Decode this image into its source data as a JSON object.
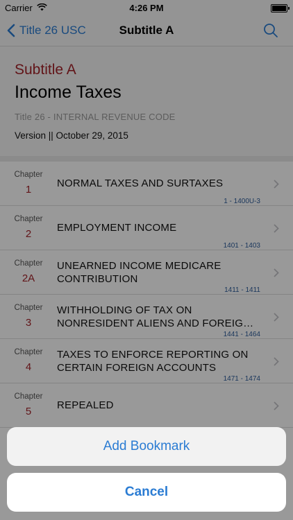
{
  "status_bar": {
    "carrier": "Carrier",
    "time": "4:26 PM",
    "battery_level": 1.0
  },
  "nav": {
    "back_label": "Title 26 USC",
    "title": "Subtitle A",
    "search_icon": "search-icon",
    "back_icon": "chevron-left-icon"
  },
  "header": {
    "subtitle": "Subtitle A",
    "title": "Income Taxes",
    "code": "Title 26 - INTERNAL REVENUE CODE",
    "version": "Version || October 29, 2015"
  },
  "chapters": [
    {
      "label": "Chapter",
      "num": "1",
      "title": "NORMAL TAXES AND SURTAXES",
      "range": "1 - 1400U-3"
    },
    {
      "label": "Chapter",
      "num": "2",
      "title": "EMPLOYMENT INCOME",
      "range": "1401 - 1403"
    },
    {
      "label": "Chapter",
      "num": "2A",
      "title": "UNEARNED INCOME MEDICARE CONTRIBUTION",
      "range": "1411 - 1411"
    },
    {
      "label": "Chapter",
      "num": "3",
      "title": "WITHHOLDING OF TAX ON NONRESIDENT ALIENS AND FOREIGN CORPORATIONS",
      "range": "1441 - 1464"
    },
    {
      "label": "Chapter",
      "num": "4",
      "title": "TAXES TO ENFORCE REPORTING ON CERTAIN FOREIGN ACCOUNTS",
      "range": "1471 - 1474"
    },
    {
      "label": "Chapter",
      "num": "5",
      "title": "REPEALED",
      "range": ""
    }
  ],
  "action_sheet": {
    "bookmark_label": "Add Bookmark",
    "cancel_label": "Cancel"
  },
  "colors": {
    "accent": "#2b7cd3",
    "chapter_red": "#a3232a"
  }
}
